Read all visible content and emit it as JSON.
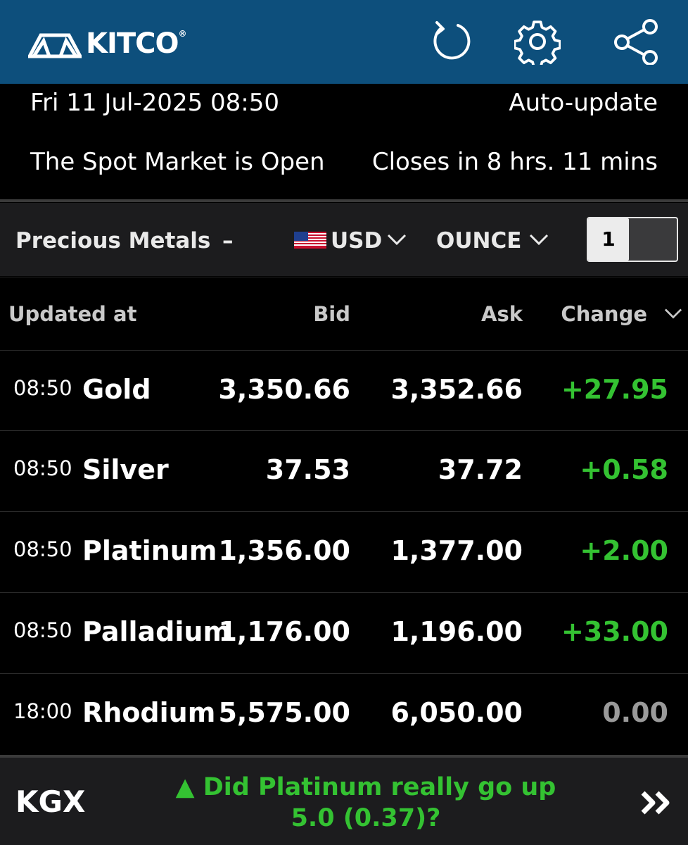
{
  "header": {
    "brand": "KITCO",
    "brand_reg": "®",
    "icons": [
      "refresh-icon",
      "gear-icon",
      "share-icon"
    ],
    "bg_color": "#0d4f7c"
  },
  "status": {
    "datetime": "Fri 11 Jul-2025 08:50",
    "auto_update": "Auto-update",
    "market_status": "The Spot Market is Open",
    "closes_in": "Closes in 8 hrs. 11 mins"
  },
  "filters": {
    "category": "Precious Metals",
    "category_toggle": "–",
    "currency": "USD",
    "unit": "OUNCE",
    "quantity": "1"
  },
  "table": {
    "headers": {
      "updated": "Updated at",
      "bid": "Bid",
      "ask": "Ask",
      "change": "Change"
    },
    "rows": [
      {
        "time": "08:50",
        "name": "Gold",
        "bid": "3,350.66",
        "ask": "3,352.66",
        "change": "+27.95"
      },
      {
        "time": "08:50",
        "name": "Silver",
        "bid": "37.53",
        "ask": "37.72",
        "change": "+0.58"
      },
      {
        "time": "08:50",
        "name": "Platinum",
        "bid": "1,356.00",
        "ask": "1,377.00",
        "change": "+2.00"
      },
      {
        "time": "08:50",
        "name": "Palladium",
        "bid": "1,176.00",
        "ask": "1,196.00",
        "change": "+33.00"
      },
      {
        "time": "18:00",
        "name": "Rhodium",
        "bid": "5,575.00",
        "ask": "6,050.00",
        "change": "0.00"
      }
    ],
    "positive_color": "#34c232",
    "neutral_color": "#9a9a9a"
  },
  "footer": {
    "label": "KGX",
    "ticker_line1": "▲ Did Platinum really go up",
    "ticker_line2": "5.0 (0.37)?"
  }
}
